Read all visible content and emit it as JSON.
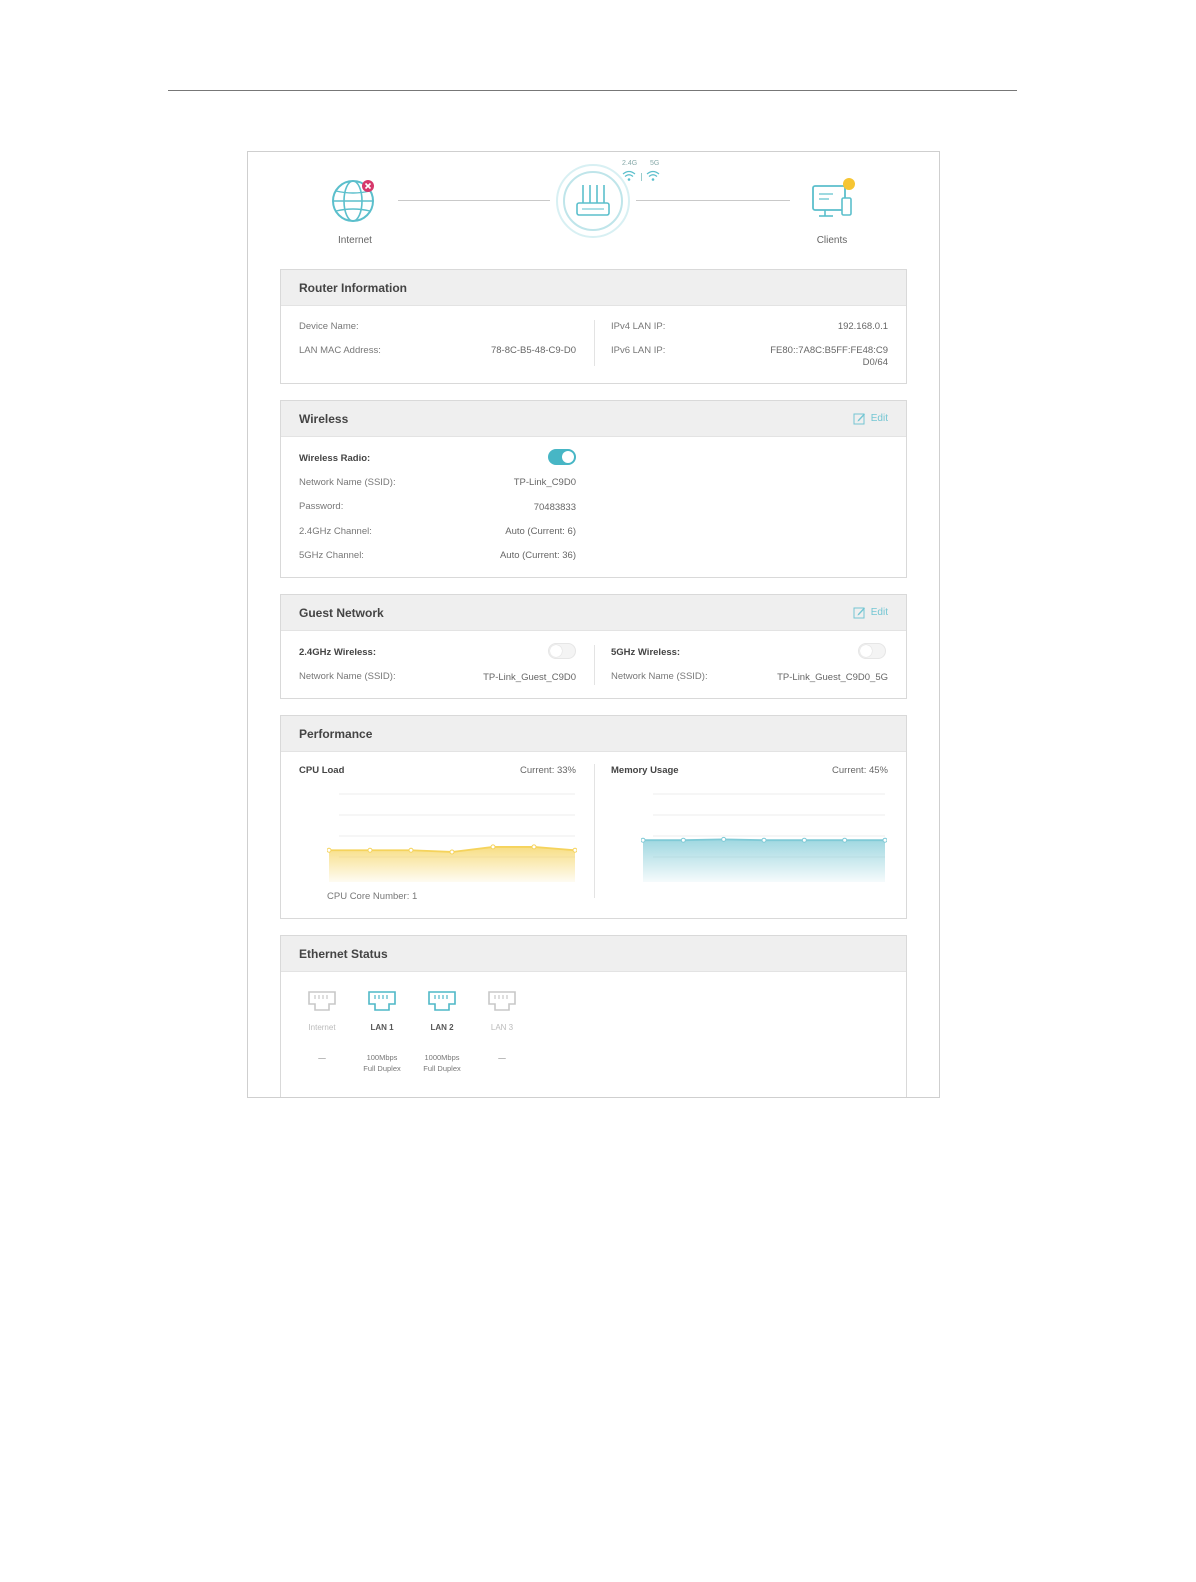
{
  "topology": {
    "internet_label": "Internet",
    "clients_label": "Clients",
    "band_24": "2.4G",
    "band_5": "5G"
  },
  "router_info": {
    "title": "Router Information",
    "device_name_label": "Device Name:",
    "device_name_value": "",
    "lan_mac_label": "LAN MAC Address:",
    "lan_mac_value": "78-8C-B5-48-C9-D0",
    "ipv4_label": "IPv4 LAN IP:",
    "ipv4_value": "192.168.0.1",
    "ipv6_label": "IPv6 LAN IP:",
    "ipv6_value_line1": "FE80::7A8C:B5FF:FE48:C9",
    "ipv6_value_line2": "D0/64"
  },
  "wireless": {
    "title": "Wireless",
    "edit_label": "Edit",
    "radio_label": "Wireless Radio:",
    "radio_on": true,
    "ssid_label": "Network Name (SSID):",
    "ssid_value": "TP-Link_C9D0",
    "password_label": "Password:",
    "password_value": "70483833",
    "ch24_label": "2.4GHz Channel:",
    "ch24_value": "Auto (Current: 6)",
    "ch5_label": "5GHz Channel:",
    "ch5_value": "Auto (Current: 36)"
  },
  "guest": {
    "title": "Guest Network",
    "edit_label": "Edit",
    "w24_label": "2.4GHz Wireless:",
    "w24_on": false,
    "w24_ssid_label": "Network Name (SSID):",
    "w24_ssid_value": "TP-Link_Guest_C9D0",
    "w5_label": "5GHz Wireless:",
    "w5_on": false,
    "w5_ssid_label": "Network Name (SSID):",
    "w5_ssid_value": "TP-Link_Guest_C9D0_5G"
  },
  "performance": {
    "title": "Performance",
    "cpu_label": "CPU Load",
    "cpu_current": "Current: 33%",
    "cpu_core": "CPU Core Number: 1",
    "mem_label": "Memory Usage",
    "mem_current": "Current: 45%",
    "colors": {
      "cpu": "#f5d35c",
      "memory": "#7fcad6"
    }
  },
  "chart_data": [
    {
      "type": "area",
      "title": "CPU Load",
      "x": [
        1,
        2,
        3,
        4,
        5,
        6,
        7
      ],
      "series": [
        {
          "values": [
            33,
            33,
            33,
            31,
            37,
            37,
            33
          ]
        }
      ],
      "ylim": [
        0,
        100
      ],
      "grid": true
    },
    {
      "type": "area",
      "title": "Memory Usage",
      "x": [
        1,
        2,
        3,
        4,
        5,
        6,
        7
      ],
      "series": [
        {
          "values": [
            45,
            45,
            46,
            45,
            45,
            45,
            45
          ]
        }
      ],
      "ylim": [
        0,
        100
      ],
      "grid": true
    }
  ],
  "ethernet": {
    "title": "Ethernet Status",
    "ports": [
      {
        "name": "Internet",
        "connected": false,
        "speed1": "—",
        "speed2": ""
      },
      {
        "name": "LAN 1",
        "connected": true,
        "speed1": "100Mbps",
        "speed2": "Full Duplex"
      },
      {
        "name": "LAN 2",
        "connected": true,
        "speed1": "1000Mbps",
        "speed2": "Full Duplex"
      },
      {
        "name": "LAN 3",
        "connected": false,
        "speed1": "—",
        "speed2": ""
      }
    ],
    "colors": {
      "connected": "#4fb8c7",
      "disconnected": "#c8c8c8"
    }
  }
}
